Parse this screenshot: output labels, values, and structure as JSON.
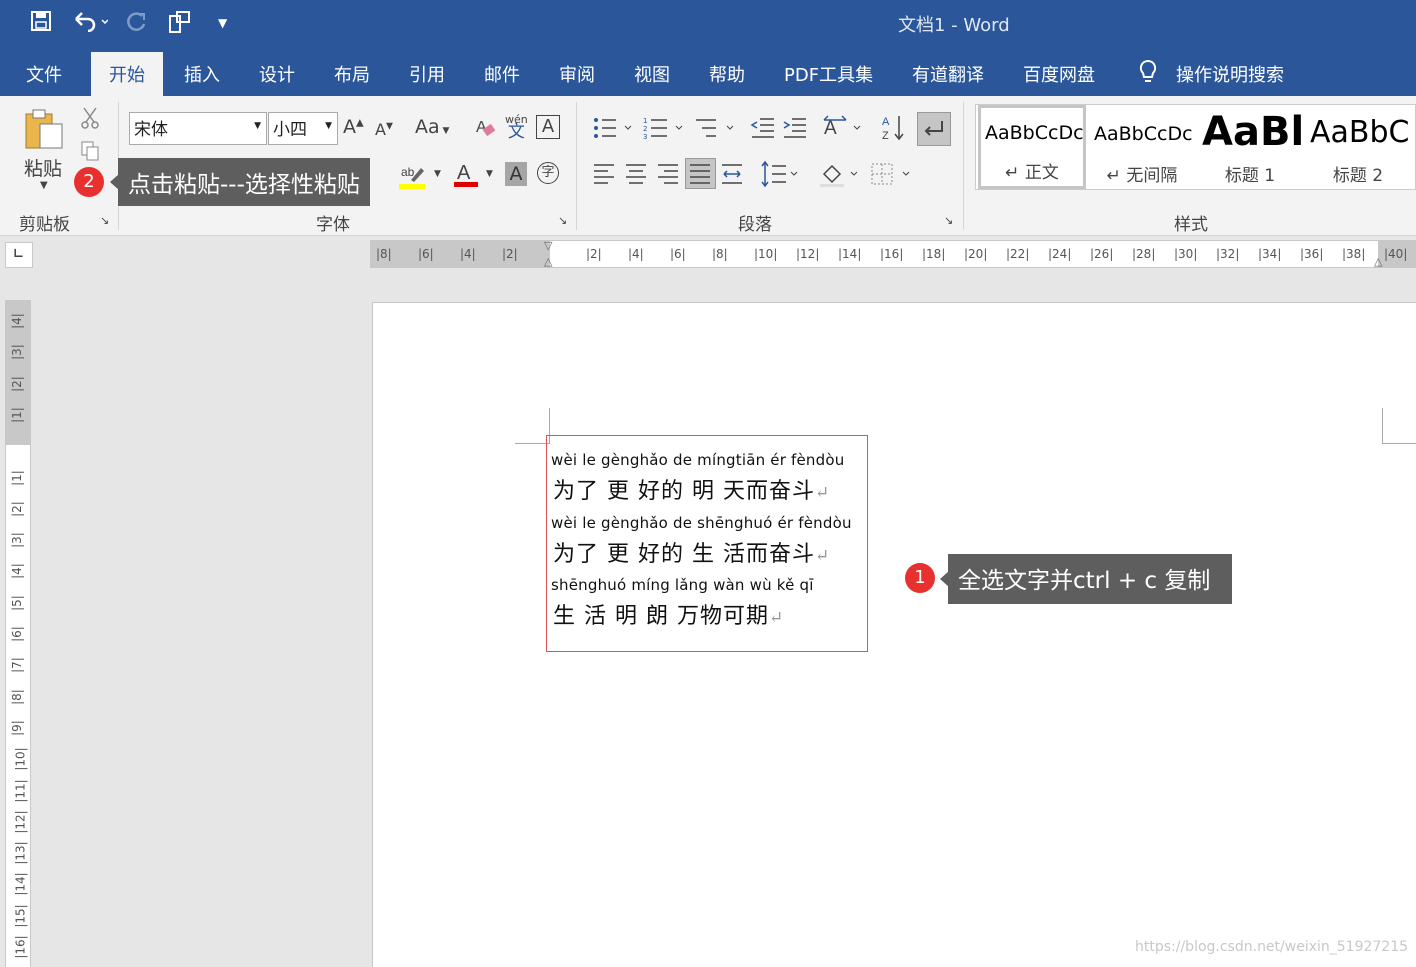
{
  "window": {
    "title": "文档1  -  Word"
  },
  "qat": {
    "save_icon": "save-icon",
    "undo_icon": "undo-icon",
    "redo_icon": "redo-icon",
    "customize_icon": "touch-mode-icon"
  },
  "tabs": [
    {
      "label": "文件"
    },
    {
      "label": "开始"
    },
    {
      "label": "插入"
    },
    {
      "label": "设计"
    },
    {
      "label": "布局"
    },
    {
      "label": "引用"
    },
    {
      "label": "邮件"
    },
    {
      "label": "审阅"
    },
    {
      "label": "视图"
    },
    {
      "label": "帮助"
    },
    {
      "label": "PDF工具集"
    },
    {
      "label": "有道翻译"
    },
    {
      "label": "百度网盘"
    },
    {
      "label": "操作说明搜索"
    }
  ],
  "ribbon": {
    "clipboard": {
      "paste_label": "粘贴",
      "group_label": "剪贴板"
    },
    "font": {
      "font_name": "宋体",
      "font_size": "小四",
      "group_label": "字体",
      "pinyin_top": "wén",
      "pinyin_bottom": "文",
      "change_case": "Aa"
    },
    "paragraph": {
      "group_label": "段落"
    },
    "styles": {
      "group_label": "样式",
      "items": [
        {
          "sample": "AaBbCcDc",
          "name": "↵ 正文"
        },
        {
          "sample": "AaBbCcDc",
          "name": "↵ 无间隔"
        },
        {
          "sample": "AaBl",
          "name": "标题 1"
        },
        {
          "sample": "AaBbC",
          "name": "标题 2"
        }
      ]
    }
  },
  "ruler": {
    "h_ticks": [
      "8",
      "6",
      "4",
      "2",
      "",
      "2",
      "4",
      "6",
      "8",
      "10",
      "12",
      "14",
      "16",
      "18",
      "20",
      "22",
      "24",
      "26",
      "28",
      "30",
      "32",
      "34",
      "36",
      "38",
      "40"
    ],
    "v_ticks": [
      "4",
      "3",
      "2",
      "1",
      "",
      "1",
      "2",
      "3",
      "4",
      "5",
      "6",
      "7",
      "8",
      "9",
      "10",
      "11",
      "12",
      "13",
      "14",
      "15",
      "16"
    ]
  },
  "document": {
    "lines": [
      {
        "pinyin": "wèi le gènghǎo de míngtiān ér fèndòu",
        "hanzi": "为了 更 好的 明 天而奋斗"
      },
      {
        "pinyin": "wèi le gènghǎo de shēnghuó ér fèndòu",
        "hanzi": "为了 更 好的 生 活而奋斗"
      },
      {
        "pinyin": "shēnghuó míng lǎng wàn wù kě  qī",
        "hanzi": " 生 活 明 朗 万物可期"
      }
    ],
    "return_mark": "↵"
  },
  "annotations": {
    "step1": {
      "num": "1",
      "text": "全选文字并ctrl + c 复制"
    },
    "step2": {
      "num": "2",
      "text": "点击粘贴---选择性粘贴"
    }
  },
  "watermark": "https://blog.csdn.net/weixin_51927215"
}
